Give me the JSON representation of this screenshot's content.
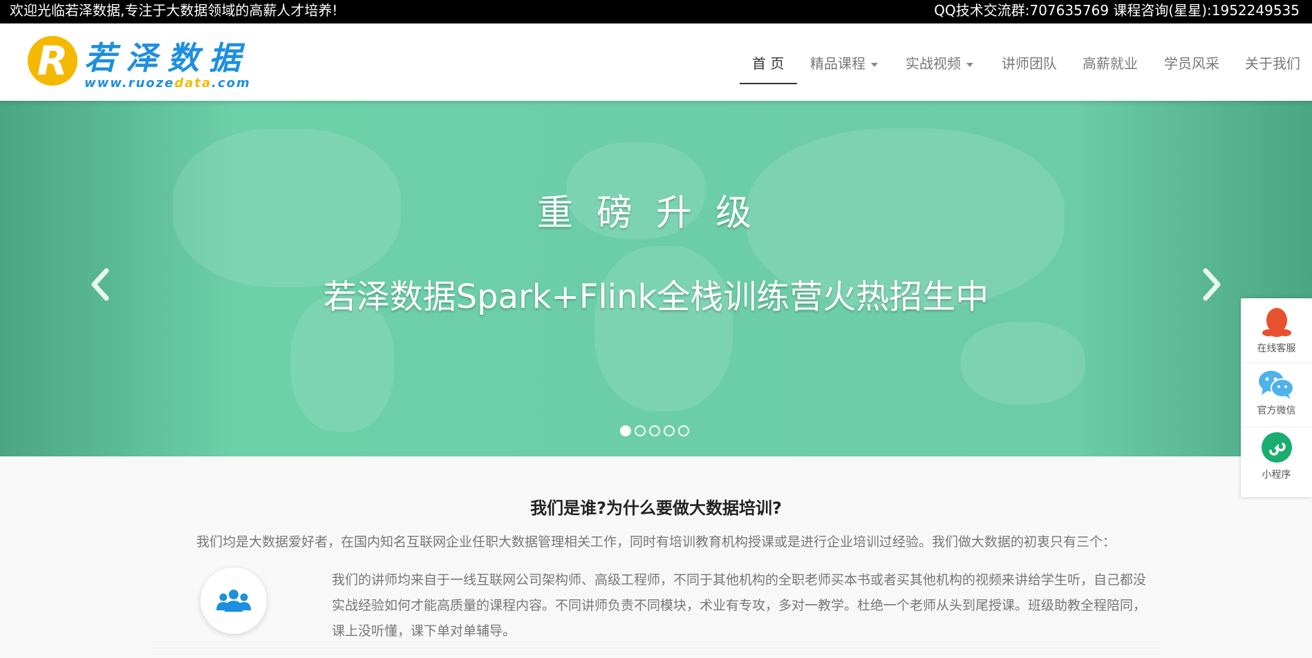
{
  "topbar": {
    "welcome": "欢迎光临若泽数据,专注于大数据领域的高薪人才培养!",
    "contact": "QQ技术交流群:707635769  课程咨询(星星):1952249535"
  },
  "logo": {
    "badge": "R",
    "name": "若泽数据",
    "url_prefix": "www.ruoze",
    "url_highlight": "data",
    "url_suffix": ".com"
  },
  "nav": {
    "items": [
      {
        "label": "首 页",
        "has_dropdown": false,
        "active": true
      },
      {
        "label": "精品课程",
        "has_dropdown": true,
        "active": false
      },
      {
        "label": "实战视频",
        "has_dropdown": true,
        "active": false
      },
      {
        "label": "讲师团队",
        "has_dropdown": false,
        "active": false
      },
      {
        "label": "高薪就业",
        "has_dropdown": false,
        "active": false
      },
      {
        "label": "学员风采",
        "has_dropdown": false,
        "active": false
      },
      {
        "label": "关于我们",
        "has_dropdown": false,
        "active": false
      }
    ]
  },
  "banner": {
    "title": "重磅升级",
    "subtitle": "若泽数据Spark+Flink全栈训练营火热招生中",
    "slide_count": 5,
    "active_slide": 1,
    "background_color": "#6ccca8"
  },
  "float_panel": {
    "items": [
      {
        "label": "在线客服",
        "icon": "qq-penguin-icon",
        "color": "#e8512e"
      },
      {
        "label": "官方微信",
        "icon": "wechat-icon",
        "color": "#4fb2ea"
      },
      {
        "label": "小程序",
        "icon": "mini-program-icon",
        "color": "#1aad6f"
      }
    ]
  },
  "intro": {
    "title": "我们是谁?为什么要做大数据培训?",
    "description": "我们均是大数据爱好者，在国内知名互联网企业任职大数据管理相关工作，同时有培训教育机构授课或是进行企业培训过经验。我们做大数据的初衷只有三个：",
    "feature1": {
      "icon": "team-icon",
      "text": "我们的讲师均来自于一线互联网公司架构师、高级工程师，不同于其他机构的全职老师买本书或者买其他机构的视频来讲给学生听，自己都没实战经验如何才能高质量的课程内容。不同讲师负责不同模块，术业有专攻，多对一教学。杜绝一个老师从头到尾授课。班级助教全程陪同，课上没听懂，课下单对单辅导。"
    }
  }
}
